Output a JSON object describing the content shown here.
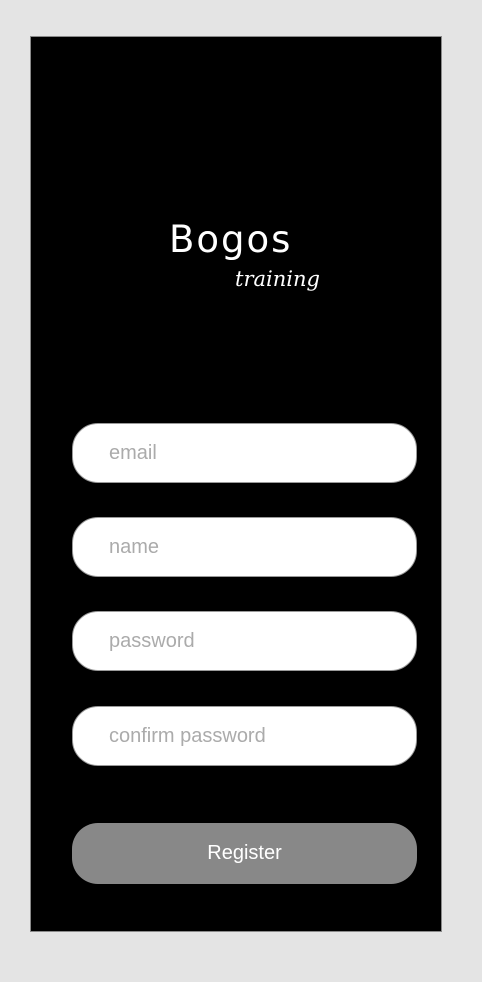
{
  "brand": {
    "title": "Bogos",
    "subtitle": "training"
  },
  "form": {
    "email": {
      "placeholder": "email",
      "value": ""
    },
    "name": {
      "placeholder": "name",
      "value": ""
    },
    "password": {
      "placeholder": "password",
      "value": ""
    },
    "confirm_password": {
      "placeholder": "confirm password",
      "value": ""
    },
    "register_label": "Register"
  },
  "colors": {
    "page_background": "#e4e4e4",
    "screen_background": "#000000",
    "field_background": "#ffffff",
    "placeholder_text": "#ababab",
    "button_background": "#888888",
    "button_text": "#ffffff"
  }
}
